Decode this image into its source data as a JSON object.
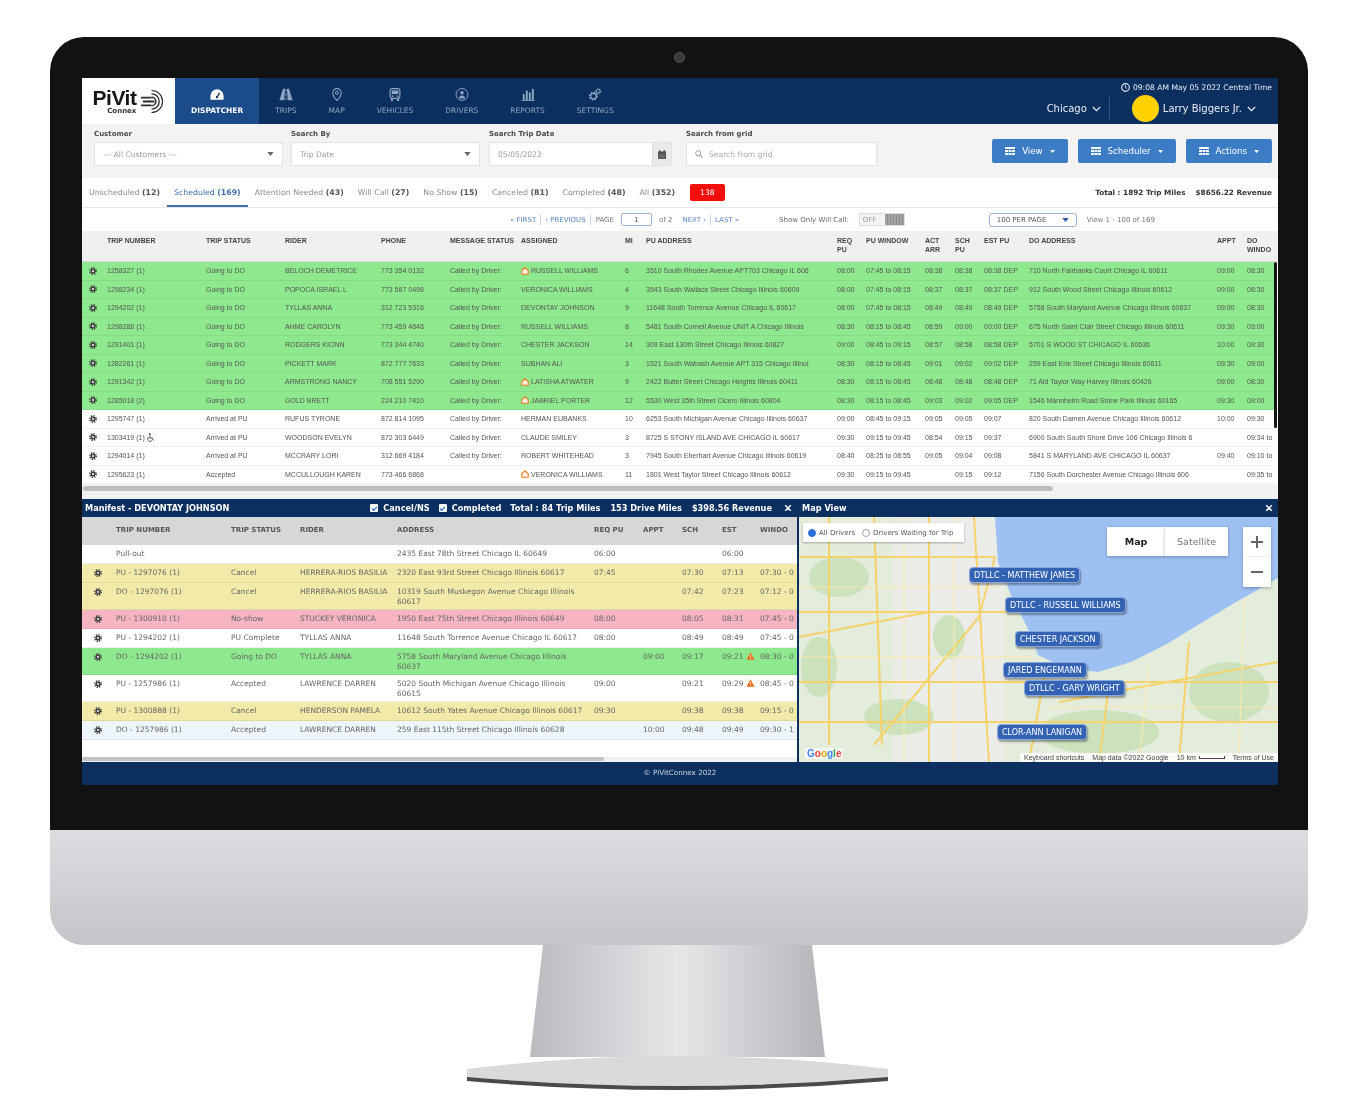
{
  "nav": {
    "logo": {
      "text": "PiVit",
      "subtext": "Connex"
    },
    "items": [
      {
        "label": "DISPATCHER",
        "selected": true
      },
      {
        "label": "TRIPS",
        "selected": false
      },
      {
        "label": "MAP",
        "selected": false
      },
      {
        "label": "VEHICLES",
        "selected": false
      },
      {
        "label": "DRIVERS",
        "selected": false
      },
      {
        "label": "REPORTS",
        "selected": false
      },
      {
        "label": "SETTINGS",
        "selected": false
      }
    ],
    "clock": "09:08 AM May 05 2022 Central Time",
    "city": "Chicago",
    "user": "Larry Biggers Jr."
  },
  "filters": {
    "fields": [
      {
        "label": "Customer",
        "kind": "select",
        "value": "--- All Customers ---"
      },
      {
        "label": "Search By",
        "kind": "select",
        "value": "Trip Date"
      },
      {
        "label": "Search Trip Date",
        "kind": "date",
        "value": "05/05/2022"
      },
      {
        "label": "Search from grid",
        "kind": "search",
        "placeholder": "Search from grid"
      }
    ],
    "buttons": [
      "View",
      "Scheduler",
      "Actions"
    ]
  },
  "tabs": [
    {
      "label": "Unscheduled",
      "count": "(12)",
      "selected": false
    },
    {
      "label": "Scheduled",
      "count": "(169)",
      "selected": true
    },
    {
      "label": "Attention Needed",
      "count": "(43)",
      "selected": false
    },
    {
      "label": "Will Call",
      "count": "(27)",
      "selected": false
    },
    {
      "label": "No Show",
      "count": "(15)",
      "selected": false
    },
    {
      "label": "Canceled",
      "count": "(81)",
      "selected": false
    },
    {
      "label": "Completed",
      "count": "(48)",
      "selected": false
    },
    {
      "label": "All",
      "count": "(352)",
      "selected": false
    }
  ],
  "alert_badge": "138",
  "totals": [
    "Total : 1892 Trip Miles",
    "$8656.22 Revenue"
  ],
  "pager": {
    "first": "« FIRST",
    "previous": "‹ PREVIOUS",
    "page_label": "PAGE",
    "page": "1",
    "page_count": "of 2",
    "next": "NEXT ›",
    "last": "LAST »"
  },
  "will_call": {
    "label": "Show Only Will Call:",
    "toggle_text": "OFF",
    "on": false
  },
  "per_page": "100 PER PAGE",
  "range": "View 1 - 100 of 169",
  "trips_table": {
    "columns": [
      "TRIP NUMBER",
      "TRIP STATUS",
      "RIDER",
      "PHONE",
      "MESSAGE STATUS",
      "ASSIGNED",
      "MI",
      "PU ADDRESS",
      "REQ PU",
      "PU WINDOW",
      "ACT ARR",
      "SCH PU",
      "EST PU",
      "DO ADDRESS",
      "APPT",
      "DO WINDO"
    ],
    "rows": [
      {
        "cells": [
          "1258327 (1)",
          "Going to DO",
          "BELOCH DEMETRICE",
          "773 354 0132",
          "Called by Driver:",
          "RUSSELL WILLIAMS",
          "6",
          "3510 South Rhodes Avenue APT703 Chicago IL 606",
          "08:00",
          "07:45 to 08:15",
          "08:38",
          "08:38",
          "08:38 DEP",
          "710 North Fairbanks Court Chicago IL 60611",
          "09:00",
          "08:30"
        ],
        "color": "#8ee88e",
        "driver_icon": true,
        "wheelchair": false
      },
      {
        "cells": [
          "1298234 (1)",
          "Going to DO",
          "POPOCA ISRAEL L",
          "773 567 0498",
          "Called by Driver:",
          "VERONICA WILLIAMS",
          "4",
          "3543 South Wallace Street Chicago Illinois 60609",
          "08:00",
          "07:45 to 08:15",
          "08:37",
          "08:37",
          "08:37 DEP",
          "912 South Wood Street Chicago Illinois 60612",
          "09:00",
          "08:30"
        ],
        "color": "#8ee88e",
        "driver_icon": false,
        "wheelchair": false
      },
      {
        "cells": [
          "1294202 (1)",
          "Going to DO",
          "TYLLAS ANNA",
          "312 723 5316",
          "Called by Driver:",
          "DEVONTAY JOHNSON",
          "9",
          "11648 South Torrence Avenue Chicago IL 60617",
          "08:00",
          "07:45 to 08:15",
          "08:49",
          "08:49",
          "08:49 DEP",
          "5758 South Maryland Avenue Chicago Illinois 60637",
          "09:00",
          "08:30"
        ],
        "color": "#8ee88e",
        "driver_icon": false,
        "wheelchair": false
      },
      {
        "cells": [
          "1298288 (1)",
          "Going to DO",
          "AHME CAROLYN",
          "773 459 4648",
          "Called by Driver:",
          "RUSSELL WILLIAMS",
          "8",
          "5481 South Cornell Avenue UNIT A Chicago Illinois",
          "08:30",
          "08:15 to 08:45",
          "08:59",
          "09:00",
          "09:00 DEP",
          "675 North Saint Clair Street Chicago Illinois 60611",
          "09:30",
          "09:00"
        ],
        "color": "#8ee88e",
        "driver_icon": false,
        "wheelchair": false
      },
      {
        "cells": [
          "1291401 (1)",
          "Going to DO",
          "RODGERS KIONN",
          "773 344 4740",
          "Called by Driver:",
          "CHESTER JACKSON",
          "14",
          "309 East 130th Street Chicago Illinois 60827",
          "09:00",
          "08:45 to 09:15",
          "08:57",
          "08:58",
          "08:58 DEP",
          "5701 S WOOD ST CHICAGO IL 60636",
          "10:00",
          "09:30"
        ],
        "color": "#8ee88e",
        "driver_icon": false,
        "wheelchair": false
      },
      {
        "cells": [
          "1282261 (1)",
          "Going to DO",
          "PICKETT MARK",
          "872 777 7633",
          "Called by Driver:",
          "SUBHAN ALI",
          "3",
          "1521 South Wabash Avenue APT 315 Chicago Illinoi",
          "08:30",
          "08:15 to 08:45",
          "09:01",
          "09:02",
          "09:02 DEP",
          "259 East Erie Street Chicago Illinois 60611",
          "09:30",
          "09:00"
        ],
        "color": "#8ee88e",
        "driver_icon": false,
        "wheelchair": false
      },
      {
        "cells": [
          "1291342 (1)",
          "Going to DO",
          "ARMSTRONG NANCY",
          "708 551 5290",
          "Called by Driver:",
          "LATISHA ATWATER",
          "9",
          "2422 Butler Street Chicago Heights Illinois 60411",
          "08:30",
          "08:15 to 08:45",
          "08:48",
          "08:48",
          "08:48 DEP",
          "71 Ald Taylor Way Harvey Illinois 60426",
          "09:00",
          "08:30"
        ],
        "color": "#8ee88e",
        "driver_icon": true,
        "wheelchair": false
      },
      {
        "cells": [
          "1285018 (2)",
          "Going to DO",
          "GOLD BRETT",
          "224 210 7410",
          "Called by Driver:",
          "JABRIEL PORTER",
          "12",
          "5530 West 35th Street Cicero Illinois 60804",
          "08:30",
          "08:15 to 08:45",
          "09:03",
          "09:02",
          "09:05 DEP",
          "1546 Mannheim Road Stone Park Illinois 60165",
          "09:30",
          "09:00"
        ],
        "color": "#8ee88e",
        "driver_icon": true,
        "wheelchair": false
      },
      {
        "cells": [
          "1295747 (1)",
          "Arrived at PU",
          "RUFUS TYRONE",
          "872 814 1095",
          "Called by Driver:",
          "HERMAN EUBANKS",
          "10",
          "6253 South Michigan Avenue Chicago Illinois 60637",
          "09:00",
          "08:45 to 09:15",
          "09:05",
          "09:05",
          "09:07",
          "820 South Damen Avenue Chicago Illinois 60612",
          "10:00",
          "09:30"
        ],
        "color": "#ffffff",
        "driver_icon": false,
        "wheelchair": false
      },
      {
        "cells": [
          "1303419 (1)",
          "Arrived at PU",
          "WOODSON EVELYN",
          "872 303 6449",
          "Called by Driver:",
          "CLAUDE SMILEY",
          "3",
          "8725 S STONY ISLAND AVE CHICAGO IL 60617",
          "09:30",
          "09:15 to 09:45",
          "08:54",
          "09:15",
          "09:37",
          "6900 South South Shore Drive 106 Chicago Illinois 6",
          null,
          "09:34 to"
        ],
        "color": "#ffffff",
        "driver_icon": false,
        "wheelchair": true
      },
      {
        "cells": [
          "1294014 (1)",
          "Arrived at PU",
          "MCCRARY LORI",
          "312 669 4184",
          "Called by Driver:",
          "ROBERT WHITEHEAD",
          "3",
          "7945 South Eberhart Avenue Chicago Illinois 60619",
          "08:40",
          "08:25 to 08:55",
          "09:05",
          "09:04",
          "09:08",
          "5841 S MARYLAND AVE CHICAGO IL 60637",
          "09:40",
          "09:10 to"
        ],
        "color": "#ffffff",
        "driver_icon": false,
        "wheelchair": false
      },
      {
        "cells": [
          "1295623 (1)",
          "Accepted",
          "MCCULLOUGH KAREN",
          "773 466 6868",
          null,
          "VERONICA WILLIAMS",
          "11",
          "1801 West Taylor Street Chicago Illinois 60612",
          "09:30",
          "09:15 to 09:45",
          null,
          "09:15",
          "09:12",
          "7156 South Dorchester Avenue Chicago Illinois 606",
          null,
          "09:35 to"
        ],
        "color": "#ffffff",
        "driver_icon": true,
        "wheelchair": false
      }
    ]
  },
  "manifest": {
    "title": "Manifest - DEVONTAY JOHNSON",
    "filters": [
      {
        "label": "Cancel/NS",
        "checked": true
      },
      {
        "label": "Completed",
        "checked": true
      }
    ],
    "totals": [
      "Total : 84 Trip Miles",
      "153 Drive Miles",
      "$398.56 Revenue"
    ],
    "columns": [
      "TRIP NUMBER",
      "TRIP STATUS",
      "RIDER",
      "ADDRESS",
      "REQ PU",
      "APPT",
      "SCH",
      "EST",
      "WINDO"
    ],
    "rows": [
      {
        "cells": [
          "Pull-out",
          null,
          null,
          "2435 East 78th Street Chicago IL 60649",
          "06:00",
          null,
          null,
          "06:00",
          null
        ],
        "color": "#ffffff",
        "gear": false,
        "warning": false
      },
      {
        "cells": [
          "PU - 1297076 (1)",
          "Cancel",
          "HERRERA-RIOS BASILIA",
          "2320 East 93rd Street Chicago Illinois 60617",
          "07:45",
          null,
          "07:30",
          "07:13",
          "07:30 - 0"
        ],
        "color": "#f2eaa8",
        "gear": true,
        "warning": false
      },
      {
        "cells": [
          "DO - 1297076 (1)",
          "Cancel",
          "HERRERA-RIOS BASILIA",
          "10319 South Muskegon Avenue Chicago Illinois 60617",
          null,
          null,
          "07:42",
          "07:23",
          "07:12 - 0"
        ],
        "color": "#f2eaa8",
        "gear": true,
        "warning": false
      },
      {
        "cells": [
          "PU - 1300910 (1)",
          "No-show",
          "STUCKEY VERONICA",
          "1950 East 75th Street Chicago Illinois 60649",
          "08:00",
          null,
          "08:05",
          "08:31",
          "07:45 - 0"
        ],
        "color": "#f7b4c3",
        "gear": true,
        "warning": false
      },
      {
        "cells": [
          "PU - 1294202 (1)",
          "PU Complete",
          "TYLLAS ANNA",
          "11648 South Torrence Avenue Chicago IL 60617",
          "08:00",
          null,
          "08:49",
          "08:49",
          "07:45 - 0"
        ],
        "color": "#ffffff",
        "gear": true,
        "warning": false
      },
      {
        "cells": [
          "DO - 1294202 (1)",
          "Going to DO",
          "TYLLAS ANNA",
          "5758 South Maryland Avenue Chicago Illinois 60637",
          null,
          "09:00",
          "09:17",
          "09:21",
          "08:30 - 0"
        ],
        "color": "#8ee88e",
        "gear": true,
        "warning": true
      },
      {
        "cells": [
          "PU - 1257986 (1)",
          "Accepted",
          "LAWRENCE DARREN",
          "5020 South Michigan Avenue Chicago Illinois 60615",
          "09:00",
          null,
          "09:21",
          "09:29",
          "08:45 - 0"
        ],
        "color": "#ffffff",
        "gear": true,
        "warning": true
      },
      {
        "cells": [
          "PU - 1300888 (1)",
          "Cancel",
          "HENDERSON PAMELA",
          "10612 South Yates Avenue Chicago Illinois 60617",
          "09:30",
          null,
          "09:38",
          "09:38",
          "09:15 - 0"
        ],
        "color": "#f2eaa8",
        "gear": true,
        "warning": false
      },
      {
        "cells": [
          "DO - 1257986 (1)",
          "Accepted",
          "LAWRENCE DARREN",
          "259 East 115th Street Chicago Illinois 60628",
          null,
          "10:00",
          "09:48",
          "09:49",
          "09:30 - 1"
        ],
        "color": "#eef5fc",
        "gear": true,
        "warning": false
      }
    ]
  },
  "map_view": {
    "title": "Map View",
    "filter_options": [
      {
        "label": "All Drivers",
        "selected": true
      },
      {
        "label": "Drivers Waiting for Trip",
        "selected": false
      }
    ],
    "map_types": [
      {
        "label": "Map",
        "selected": true
      },
      {
        "label": "Satellite",
        "selected": false
      }
    ],
    "drivers": [
      "DTLLC - MATTHEW JAMES",
      "DTLLC - RUSSELL WILLIAMS",
      "CHESTER JACKSON",
      "JARED ENGEMANN",
      "DTLLC - GARY WRIGHT",
      "CLOR-ANN LANIGAN"
    ],
    "logo": "Google",
    "attribution": [
      "Keyboard shortcuts",
      "Map data ©2022 Google",
      "10 km",
      "Terms of Use"
    ]
  },
  "footer": "© PiVitConnex 2022"
}
